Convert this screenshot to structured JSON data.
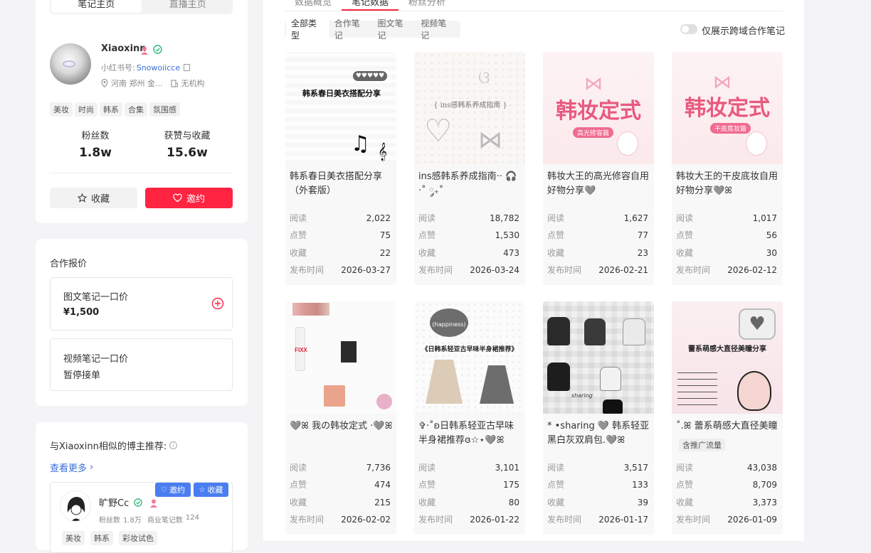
{
  "left": {
    "top_tabs": [
      "笔记主页",
      "直播主页"
    ],
    "profile": {
      "name": "Xiaoxinn",
      "id_label": "小红书号:",
      "id_value": "Snowoiicce",
      "location": "河南 郑州 金...",
      "org": "无机构",
      "tags": [
        "美妆",
        "时尚",
        "韩系",
        "合集",
        "氛围感"
      ],
      "fans_label": "粉丝数",
      "fans_value": "1.8w",
      "likes_label": "获赞与收藏",
      "likes_value": "15.6w",
      "fav_button": "收藏",
      "invite_button": "邀约"
    },
    "pricing": {
      "title": "合作报价",
      "image_note_label": "图文笔记一口价",
      "image_note_price": "¥1,500",
      "video_note_label": "视频笔记一口价",
      "video_note_price": "暂停接单"
    },
    "similar": {
      "title": "与Xiaoxinn相似的博主推荐:",
      "more": "查看更多",
      "blogger": {
        "name": "旷野Cc",
        "fans_label": "粉丝数",
        "fans_value": "1.8万",
        "biz_label": "商业笔记数",
        "biz_value": "124",
        "tags": [
          "美妆",
          "韩系",
          "彩妆试色"
        ],
        "invite": "邀约",
        "fav": "收藏"
      }
    }
  },
  "main": {
    "tabs": [
      "数据概览",
      "笔记数据",
      "粉丝分析"
    ],
    "active_tab": 1,
    "filters": [
      "全部类型",
      "合作笔记",
      "图文笔记",
      "视频笔记"
    ],
    "toggle_label": "仅展示跨域合作笔记",
    "stat_labels": [
      "阅读",
      "点赞",
      "收藏",
      "发布时间"
    ],
    "notes": [
      {
        "title": "韩系春日美衣搭配分享（外套版）",
        "cover": "韩系春日美衣搭配分享",
        "reads": "2,022",
        "likes": "75",
        "favs": "22",
        "date": "2026-03-27"
      },
      {
        "title": "ins感韩系养成指南·· 🎧 ·˚ ༘₊˚",
        "cover": "{ ins感韩系养成指南 }",
        "reads": "18,782",
        "likes": "1,530",
        "favs": "473",
        "date": "2026-03-24"
      },
      {
        "title": "韩妆大王的高光修容自用好物分享🩶",
        "cover": "韩妆定式",
        "cover_sub": "高光修容篇",
        "reads": "1,627",
        "likes": "77",
        "favs": "23",
        "date": "2026-02-21"
      },
      {
        "title": "韩妆大王的干皮底妆自用好物分享🩶ꕤ",
        "cover": "韩妆定式",
        "cover_sub": "干皮底妆篇",
        "reads": "1,017",
        "likes": "56",
        "favs": "30",
        "date": "2026-02-12"
      },
      {
        "title": "🩶ꕤ 我の韩妆定式 ·🩶ꕤ",
        "cover": "FIXX",
        "reads": "7,736",
        "likes": "474",
        "favs": "215",
        "date": "2026-02-02"
      },
      {
        "title": "✞·˚ʚ日韩系轻亚古早味半身裙推荐ɞ☆⋆🩶ꕤ",
        "cover": "《日韩系轻亚古早味半身裙推荐》",
        "cover_bubble": "(happiness)",
        "reads": "3,101",
        "likes": "175",
        "favs": "80",
        "date": "2026-01-22"
      },
      {
        "title": "* •sharing 🩶 韩系轻亚黑白灰双肩包.🩶ꕤ",
        "cover": "sharing",
        "reads": "3,517",
        "likes": "133",
        "favs": "39",
        "date": "2026-01-17"
      },
      {
        "title": "˚.ꕤ 蕾系萌感大直径美瞳分享...",
        "cover": "蕾系萌感大直径美瞳分享",
        "badge": "含推广流量",
        "reads": "43,038",
        "likes": "8,709",
        "favs": "3,373",
        "date": "2026-01-09"
      }
    ]
  }
}
